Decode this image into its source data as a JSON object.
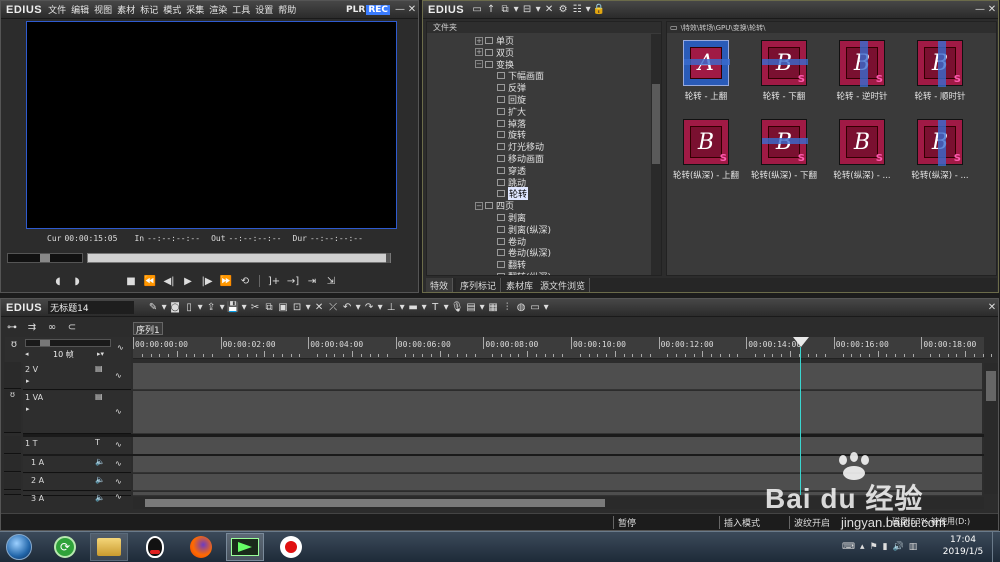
{
  "player": {
    "app_name": "EDIUS",
    "menu": [
      "文件",
      "编辑",
      "视图",
      "素材",
      "标记",
      "模式",
      "采集",
      "渲染",
      "工具",
      "设置",
      "帮助"
    ],
    "plr_label": "PLR",
    "rec_label": "REC",
    "cur_label": "Cur",
    "cur_value": "00:00:15:05",
    "in_label": "In",
    "in_value": "--:--:--:--",
    "out_label": "Out",
    "out_value": "--:--:--:--",
    "dur_label": "Dur",
    "dur_value": "--:--:--:--"
  },
  "effects": {
    "app_name": "EDIUS",
    "folder_header": "文件夹",
    "path": "\\特效\\转场\\GPU\\变换\\轮转\\",
    "tree": [
      {
        "label": "单页",
        "level": 1,
        "expanded": false
      },
      {
        "label": "双页",
        "level": 1,
        "expanded": false
      },
      {
        "label": "变换",
        "level": 1,
        "expanded": true
      },
      {
        "label": "下幅画面",
        "level": 2
      },
      {
        "label": "反弹",
        "level": 2
      },
      {
        "label": "回旋",
        "level": 2
      },
      {
        "label": "扩大",
        "level": 2
      },
      {
        "label": "掉落",
        "level": 2
      },
      {
        "label": "旋转",
        "level": 2
      },
      {
        "label": "灯光移动",
        "level": 2
      },
      {
        "label": "移动画面",
        "level": 2
      },
      {
        "label": "穿透",
        "level": 2
      },
      {
        "label": "跳动",
        "level": 2
      },
      {
        "label": "轮转",
        "level": 2,
        "selected": true
      },
      {
        "label": "四页",
        "level": 1,
        "expanded": true
      },
      {
        "label": "剥离",
        "level": 2
      },
      {
        "label": "剥离(纵深)",
        "level": 2
      },
      {
        "label": "卷动",
        "level": 2
      },
      {
        "label": "卷动(纵深)",
        "level": 2
      },
      {
        "label": "翻转",
        "level": 2
      },
      {
        "label": "翻转(纵深)",
        "level": 2
      }
    ],
    "items": [
      {
        "caption": "轮转 - 上翻",
        "selected": true
      },
      {
        "caption": "轮转 - 下翻"
      },
      {
        "caption": "轮转 - 逆时针"
      },
      {
        "caption": "轮转 - 顺时针"
      },
      {
        "caption": "轮转(纵深) - 上翻"
      },
      {
        "caption": "轮转(纵深) - 下翻"
      },
      {
        "caption": "轮转(纵深) - ..."
      },
      {
        "caption": "轮转(纵深) - ..."
      }
    ],
    "tabs": [
      "特效",
      "序列标记",
      "素材库",
      "源文件浏览"
    ]
  },
  "timeline": {
    "app_name": "EDIUS",
    "project_name": "无标题14",
    "sequence_tab": "序列1",
    "zoom_label": "10 帧",
    "ruler": [
      "00:00:00:00",
      "00:00:02:00",
      "00:00:04:00",
      "00:00:06:00",
      "00:00:08:00",
      "00:00:10:00",
      "00:00:12:00",
      "00:00:14:00",
      "00:00:16:00",
      "00:00:18:00"
    ],
    "tracks": [
      "2 V",
      "1 VA",
      "1 T",
      "1 A",
      "2 A",
      "3 A"
    ],
    "status": [
      "暂停",
      "插入模式",
      "波纹开启",
      "磁盘:53% 被使用(D:)"
    ]
  },
  "taskbar": {
    "time": "17:04",
    "date": "2019/1/5"
  },
  "watermark": {
    "brand": "Bai du 经验",
    "url": "jingyan.baidu.com"
  },
  "colors": {
    "accent_blue": "#2f5bd0",
    "rec_bg": "#3a7cff",
    "thumb_bg": "#a01a45",
    "playhead": "#3ad6d0"
  }
}
